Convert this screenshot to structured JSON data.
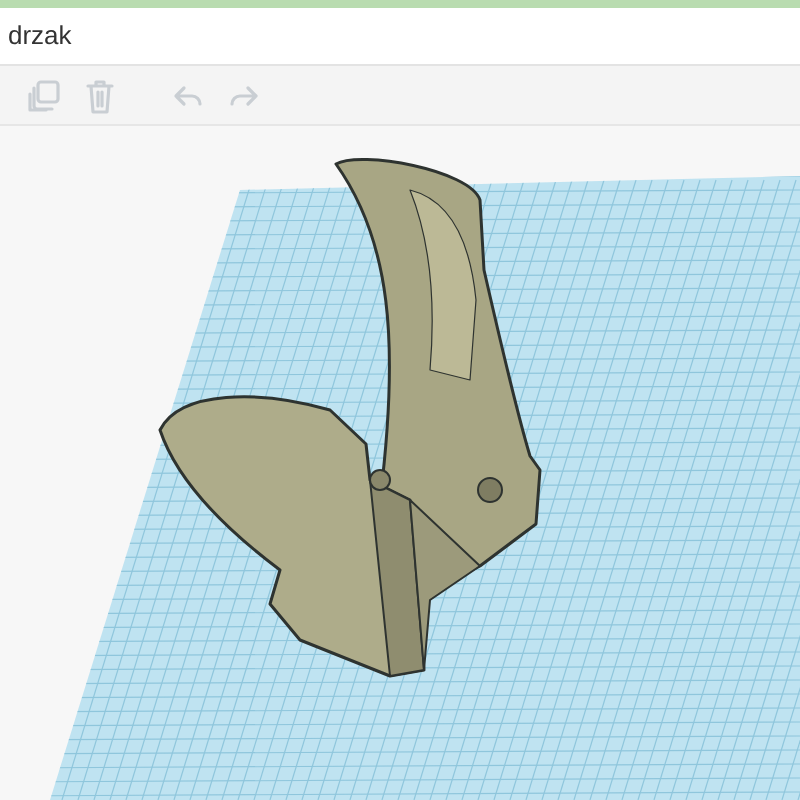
{
  "window": {
    "title": "drzak"
  },
  "toolbar": [
    {
      "kind": "copy",
      "disabled": true
    },
    {
      "kind": "delete",
      "disabled": true
    },
    {
      "kind": "undo",
      "disabled": true
    },
    {
      "kind": "redo",
      "disabled": true
    }
  ]
}
